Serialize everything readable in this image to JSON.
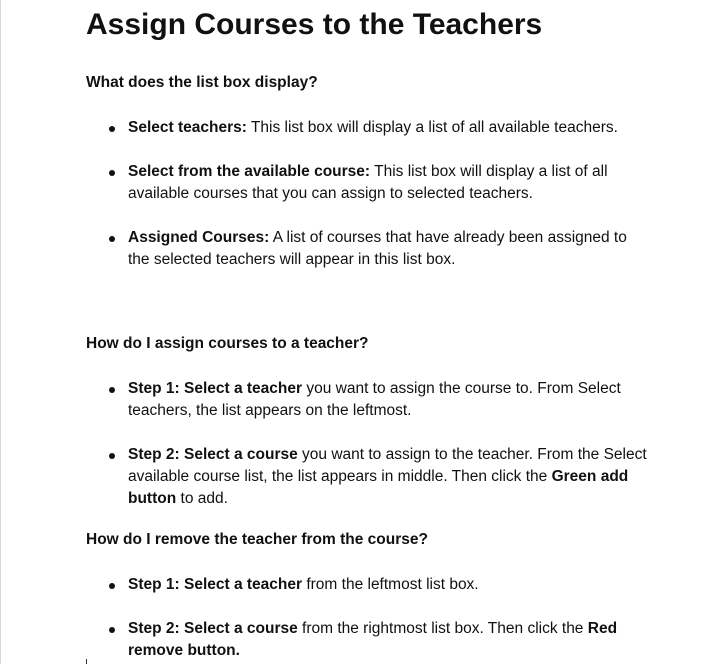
{
  "title": "Assign Courses to the Teachers",
  "sections": [
    {
      "question": "What does the list box display?",
      "items": [
        {
          "bold": "Select teachers:",
          "text": " This list box will display a list of all available teachers."
        },
        {
          "bold": "Select from the available course:",
          "text": " This list box will display a list of all available courses that you can assign to selected teachers."
        },
        {
          "bold": "Assigned Courses:",
          "text": " A list of courses that have already been assigned to the selected teachers will appear in this list box."
        }
      ]
    },
    {
      "question": "How do I assign courses to a teacher?",
      "items": [
        {
          "bold": "Step 1: Select a teacher",
          "text": " you want to assign the course to. From Select teachers, the list appears on the leftmost."
        },
        {
          "bold": "Step 2: Select a course",
          "text": " you want to assign to the teacher. From the Select available course list, the list appears in middle. Then click the ",
          "bold2": "Green add button",
          "text2": " to add."
        }
      ]
    },
    {
      "question": "How do I remove the teacher from the course?",
      "items": [
        {
          "bold": "Step 1: Select a teacher",
          "text": " from the leftmost list box."
        },
        {
          "bold": "Step 2: Select a course",
          "text": " from the rightmost list box. Then click the ",
          "bold2": "Red remove button."
        }
      ]
    }
  ]
}
